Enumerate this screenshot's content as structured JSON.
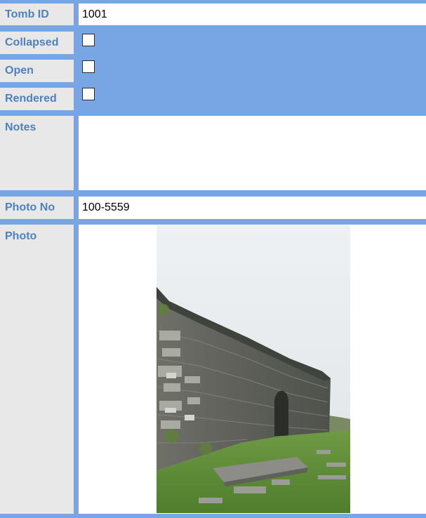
{
  "form": {
    "tomb_id": {
      "label": "Tomb ID",
      "value": "1001"
    },
    "collapsed": {
      "label": "Collapsed",
      "checked": false
    },
    "open": {
      "label": "Open",
      "checked": false
    },
    "rendered": {
      "label": "Rendered",
      "checked": false
    },
    "notes": {
      "label": "Notes",
      "value": ""
    },
    "photo_no": {
      "label": "Photo No",
      "value": "100-5559"
    },
    "photo": {
      "label": "Photo"
    }
  },
  "colors": {
    "background": "#78a6e4",
    "label_bg": "#e8e8e8",
    "label_text": "#4f81bd"
  }
}
